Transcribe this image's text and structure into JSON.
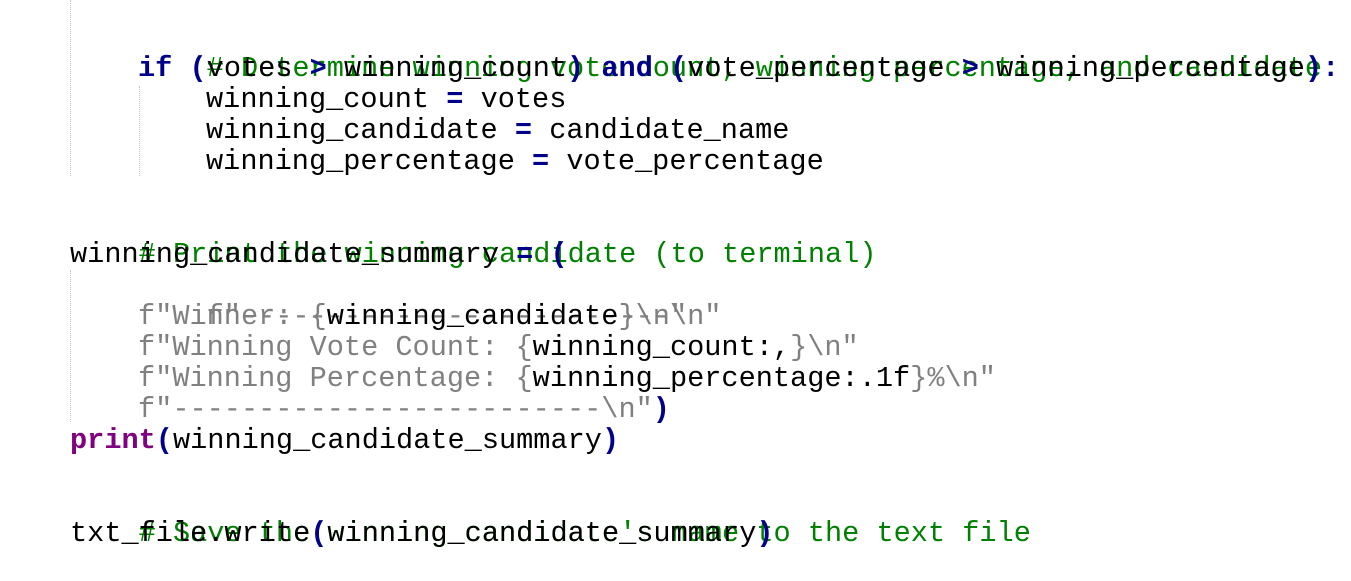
{
  "editor": {
    "colors": {
      "comment": "#008000",
      "keyword": "#00008b",
      "builtin": "#800080",
      "string": "#808080",
      "text": "#000000",
      "background": "#ffffff"
    },
    "code": {
      "l1_comment": "# Determine winning vote count, winning percentage, and candidate.",
      "l2_kw_if": "if",
      "l2_paren_open": " (",
      "l2_votes": "votes ",
      "l2_gt1": ">",
      "l2_winning_count": " winning_count",
      "l2_paren_close": ")",
      "l2_sp1": " ",
      "l2_kw_and": "and",
      "l2_paren_open2": " (",
      "l2_vote_percentage": "vote_percentage ",
      "l2_gt2": ">",
      "l2_winning_percentage": " winning_percentage",
      "l2_end": "):",
      "l3_lhs": "winning_count ",
      "l3_eq": "=",
      "l3_rhs": " votes",
      "l4_lhs": "winning_candidate ",
      "l4_eq": "=",
      "l4_rhs": " candidate_name",
      "l5_lhs": "winning_percentage ",
      "l5_eq": "=",
      "l5_rhs": " vote_percentage",
      "l6_comment": "# Print the winning candidate (to terminal)",
      "l7_lhs": "winning_candidate_summary ",
      "l7_eq": "=",
      "l7_sp": " ",
      "l7_paren": "(",
      "l8_str": "f\"-------------------------\\n\"",
      "l9_str_a": "f\"Winner: {",
      "l9_var": "winning_candidate",
      "l9_str_b": "}\\n\"",
      "l10_str_a": "f\"Winning Vote Count: {",
      "l10_var": "winning_count:,",
      "l10_str_b": "}\\n\"",
      "l11_str_a": "f\"Winning Percentage: {",
      "l11_var": "winning_percentage:.1f",
      "l11_str_b": "}%\\n\"",
      "l12_str": "f\"-------------------------\\n\"",
      "l12_paren": ")",
      "l13_builtin": "print",
      "l13_open": "(",
      "l13_arg": "winning_candidate_summary",
      "l13_close": ")",
      "l14_comment": "# Save the winning candidate's name to the text file",
      "l15_obj": "txt_file.write",
      "l15_open": "(",
      "l15_arg": "winning_candidate_summary",
      "l15_close": ")"
    }
  }
}
